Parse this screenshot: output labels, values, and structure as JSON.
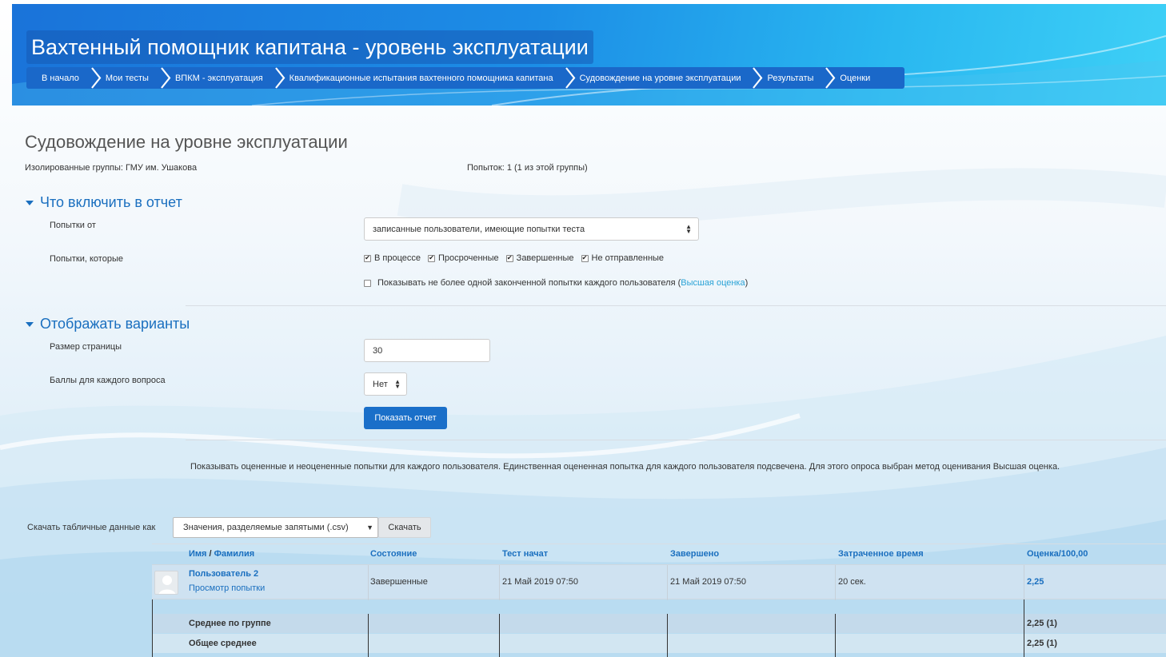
{
  "header": {
    "title": "Вахтенный помощник капитана - уровень эксплуатации",
    "breadcrumbs": [
      "В начало",
      "Мои тесты",
      "ВПКМ - эксплуатация",
      "Квалификационные испытания вахтенного помощника капитана",
      "Судовождение на уровне эксплуатации",
      "Результаты",
      "Оценки"
    ]
  },
  "page": {
    "heading": "Судовождение на уровне эксплуатации",
    "groups": "Изолированные группы: ГМУ им. Ушакова",
    "attempts": "Попыток: 1 (1 из этой группы)"
  },
  "report_section": {
    "title": "Что включить в отчет",
    "attempts_from_label": "Попытки от",
    "attempts_from_value": "записанные пользователи, имеющие попытки теста",
    "attempts_that_label": "Попытки, которые",
    "states": [
      {
        "label": "В процессе",
        "checked": true
      },
      {
        "label": "Просроченные",
        "checked": true
      },
      {
        "label": "Завершенные",
        "checked": true
      },
      {
        "label": "Не отправленные",
        "checked": true
      }
    ],
    "single_attempt_text": "Показывать не более одной законченной попытки каждого пользователя (",
    "single_attempt_link": "Высшая оценка",
    "single_attempt_close": ")",
    "single_attempt_checked": false
  },
  "display_section": {
    "title": "Отображать варианты",
    "page_size_label": "Размер страницы",
    "page_size_value": "30",
    "marks_label": "Баллы для каждого вопроса",
    "marks_value": "Нет",
    "show_button": "Показать отчет"
  },
  "info_text": "Показывать оцененные и неоцененные попытки для каждого пользователя. Единственная оцененная попытка для каждого пользователя подсвечена. Для этого опроса выбран метод оценивания Высшая оценка.",
  "download": {
    "label": "Скачать табличные данные как",
    "format": "Значения, разделяемые запятыми (.csv)",
    "button": "Скачать"
  },
  "table": {
    "headers": {
      "first_name": "Имя",
      "slash": " / ",
      "last_name": "Фамилия",
      "state": "Состояние",
      "started": "Тест начат",
      "completed": "Завершено",
      "time_taken": "Затраченное время",
      "grade": "Оценка/100,00"
    },
    "rows": [
      {
        "user": "Пользователь 2",
        "review": "Просмотр попытки",
        "state": "Завершенные",
        "started": "21 Май 2019 07:50",
        "completed": "21 Май 2019 07:50",
        "time_taken": "20 сек.",
        "grade": "2,25"
      }
    ],
    "group_average_label": "Среднее по группе",
    "group_average_value": "2,25 (1)",
    "overall_average_label": "Общее среднее",
    "overall_average_value": "2,25 (1)"
  }
}
